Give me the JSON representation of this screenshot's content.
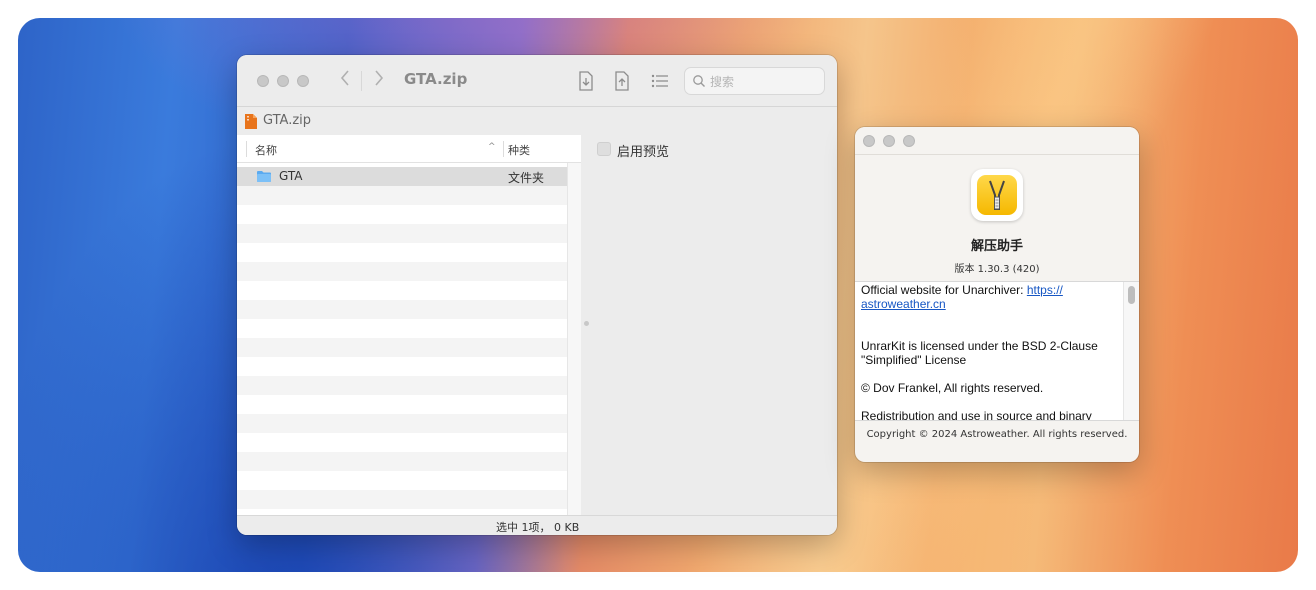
{
  "archive_window": {
    "title": "GTA.zip",
    "search_placeholder": "搜索",
    "path": "GTA.zip",
    "columns": {
      "name": "名称",
      "sort_indicator": "^",
      "kind": "种类"
    },
    "rows": [
      {
        "name": "GTA",
        "kind": "文件夹",
        "selected": true
      }
    ],
    "preview_label": "启用预览",
    "status": "选中 1项， 0 KB",
    "icons": [
      "extract-icon",
      "compress-icon",
      "list-view-icon",
      "search-icon"
    ]
  },
  "about_window": {
    "app_name": "解压助手",
    "version": "版本 1.30.3 (420)",
    "credits": {
      "website_prefix": "Official website for Unarchiver: ",
      "website_link_1": "https://",
      "website_link_2": "astroweather.cn",
      "license_1": "UnrarKit is licensed under the BSD 2-Clause",
      "license_2": "\"Simplified\" License",
      "rights": "© Dov Frankel, All rights reserved.",
      "redistribution": "Redistribution and use in source and binary"
    },
    "copyright": "Copyright © 2024 Astroweather. All rights reserved."
  },
  "colors": {
    "accent_link": "#1757c4",
    "folder_blue": "#5aaaf0",
    "zip_orange": "#e8741c",
    "app_yellow": "#f5b800"
  }
}
